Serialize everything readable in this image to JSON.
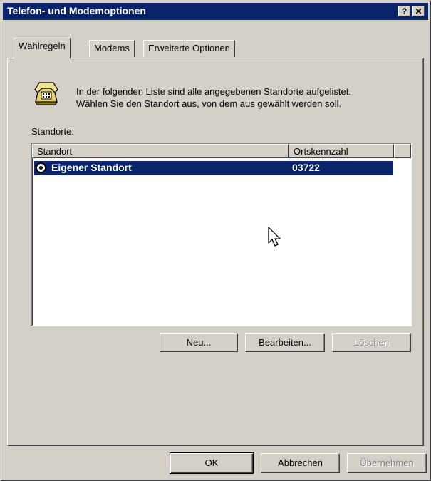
{
  "window": {
    "title": "Telefon- und Modemoptionen",
    "help_button": "?",
    "close_button": "✕"
  },
  "tabs": [
    {
      "label": "Wählregeln",
      "active": true
    },
    {
      "label": "Modems",
      "active": false
    },
    {
      "label": "Erweiterte Optionen",
      "active": false
    }
  ],
  "info": {
    "line1": "In der folgenden Liste sind alle angegebenen Standorte aufgelistet.",
    "line2": "Wählen Sie den Standort aus, von dem aus gewählt werden soll.",
    "icon": "telephone-icon"
  },
  "locations": {
    "label": "Standorte:",
    "columns": [
      "Standort",
      "Ortskennzahl"
    ],
    "rows": [
      {
        "name": "Eigener Standort",
        "area_code": "03722",
        "selected": true
      }
    ]
  },
  "list_buttons": {
    "new": "Neu...",
    "edit": "Bearbeiten...",
    "delete": "Löschen"
  },
  "dialog_buttons": {
    "ok": "OK",
    "cancel": "Abbrechen",
    "apply": "Übernehmen"
  },
  "colors": {
    "face": "#d4d0c8",
    "titlebar": "#0a246a",
    "selection": "#0a246a"
  }
}
